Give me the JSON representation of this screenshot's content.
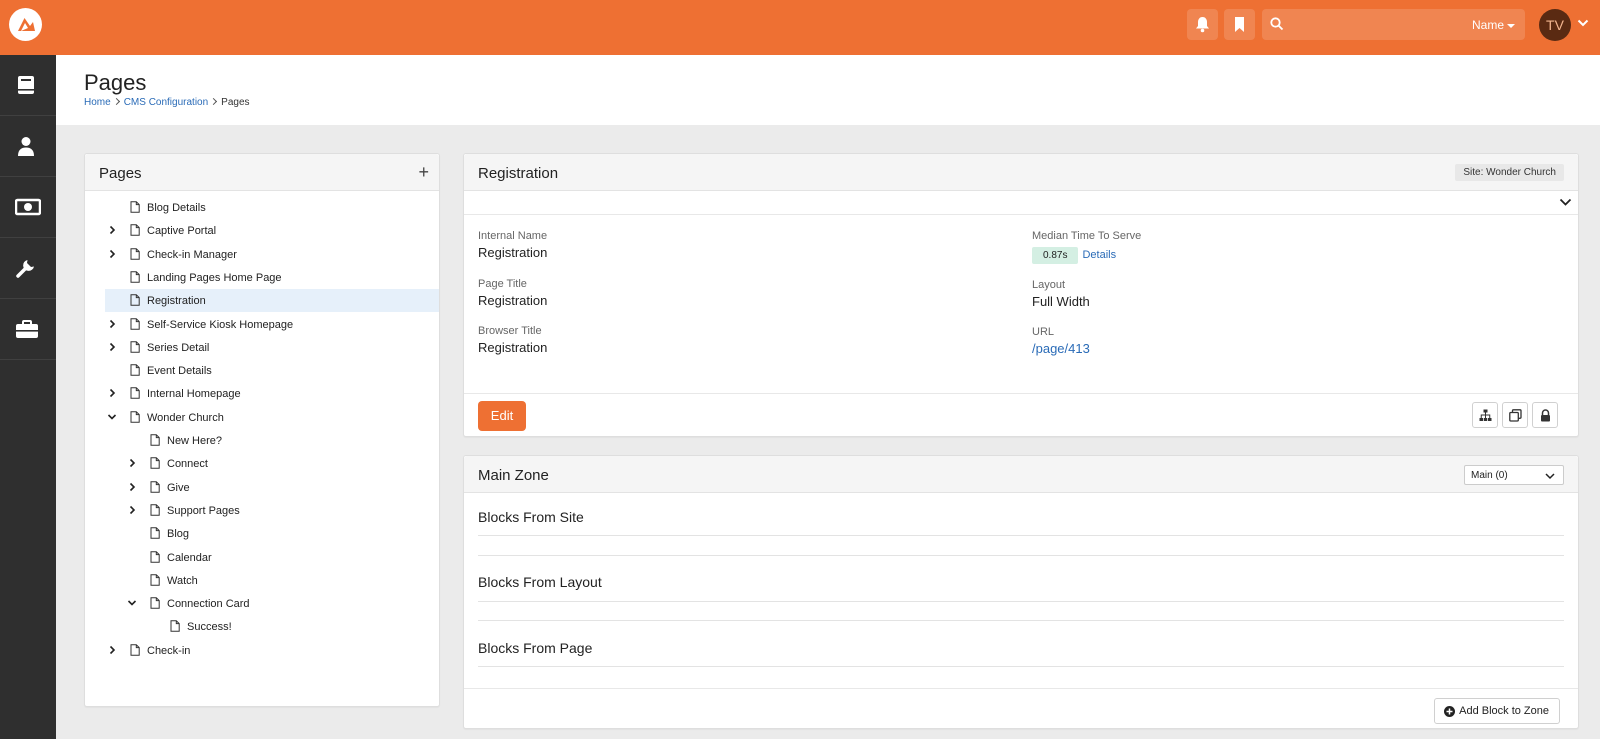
{
  "header": {
    "search_filter": "Name",
    "user_initials": "TV"
  },
  "page": {
    "title": "Pages",
    "breadcrumbs": [
      "Home",
      "CMS Configuration",
      "Pages"
    ]
  },
  "tree": {
    "title": "Pages",
    "add_label": "+",
    "items": [
      {
        "label": "Blog Details",
        "expander": "none"
      },
      {
        "label": "Captive Portal",
        "expander": "collapsed"
      },
      {
        "label": "Check-in Manager",
        "expander": "collapsed"
      },
      {
        "label": "Landing Pages Home Page",
        "expander": "none"
      },
      {
        "label": "Registration",
        "expander": "none",
        "selected": true
      },
      {
        "label": "Self-Service Kiosk Homepage",
        "expander": "collapsed"
      },
      {
        "label": "Series Detail",
        "expander": "collapsed"
      },
      {
        "label": "Event Details",
        "expander": "none"
      },
      {
        "label": "Internal Homepage",
        "expander": "collapsed"
      },
      {
        "label": "Wonder Church",
        "expander": "expanded"
      },
      {
        "label": "New Here?",
        "expander": "none",
        "level": 1
      },
      {
        "label": "Connect",
        "expander": "collapsed",
        "level": 1
      },
      {
        "label": "Give",
        "expander": "collapsed",
        "level": 1
      },
      {
        "label": "Support Pages",
        "expander": "collapsed",
        "level": 1
      },
      {
        "label": "Blog",
        "expander": "none",
        "level": 1
      },
      {
        "label": "Calendar",
        "expander": "none",
        "level": 1
      },
      {
        "label": "Watch",
        "expander": "none",
        "level": 1
      },
      {
        "label": "Connection Card",
        "expander": "expanded",
        "level": 1
      },
      {
        "label": "Success!",
        "expander": "none",
        "level": 2
      },
      {
        "label": "Check-in",
        "expander": "collapsed"
      }
    ]
  },
  "detail": {
    "title": "Registration",
    "site_badge": "Site: Wonder Church",
    "internal_name_label": "Internal Name",
    "internal_name": "Registration",
    "page_title_label": "Page Title",
    "page_title": "Registration",
    "browser_title_label": "Browser Title",
    "browser_title": "Registration",
    "median_label": "Median Time To Serve",
    "median_value": "0.87s",
    "details_link": "Details",
    "layout_label": "Layout",
    "layout_value": "Full Width",
    "url_label": "URL",
    "url_value": "/page/413",
    "edit_label": "Edit"
  },
  "zone": {
    "title": "Main Zone",
    "select_value": "Main (0)",
    "sections": [
      "Blocks From Site",
      "Blocks From Layout",
      "Blocks From Page"
    ],
    "add_block_label": "Add Block to Zone"
  },
  "colors": {
    "brand": "#ee7033",
    "sidebar": "#2f2f2f",
    "link": "#2a6bb7",
    "selected_row": "#e6f0fa",
    "timing_badge": "#d4efe3"
  },
  "icons": {
    "sidebar": [
      "book-icon",
      "person-icon",
      "money-icon",
      "wrench-icon",
      "briefcase-icon"
    ],
    "topbar": [
      "bell-icon",
      "bookmark-icon",
      "search-icon"
    ],
    "page_actions": [
      "sitemap-icon",
      "copy-icon",
      "lock-icon"
    ]
  }
}
